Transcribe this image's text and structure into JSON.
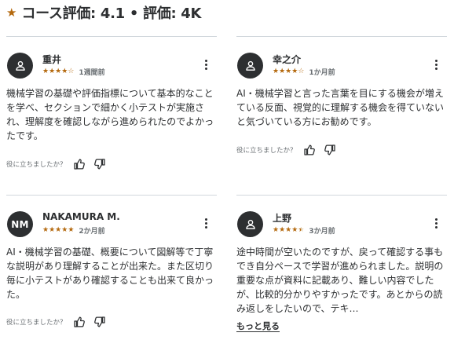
{
  "header": {
    "title": "コース評価: 4.1 • 評価: 4K",
    "star_icon": "star-icon",
    "accent_color": "#b4690e"
  },
  "helpful_label": "役に立ちましたか？",
  "reviews": [
    {
      "name": "重井",
      "avatar_icon": "user-icon",
      "avatar_initials": "",
      "rating": 4,
      "time": "1週間前",
      "text": "機械学習の基礎や評価指標について基本的なことを学べ、セクションで細かく小テストが実施され、理解度を確認しながら進められたのでよかったです。"
    },
    {
      "name": "幸之介",
      "avatar_icon": "user-icon",
      "avatar_initials": "",
      "rating": 4,
      "time": "1か月前",
      "text": "AI・機械学習と言った言葉を目にする機会が増えている反面、視覚的に理解する機会を得ていないと気づいている方にお勧めです。"
    },
    {
      "name": "NAKAMURA M.",
      "avatar_icon": "",
      "avatar_initials": "NM",
      "rating": 5,
      "time": "2か月前",
      "text": "AI・機械学習の基礎、概要について図解等で丁寧な説明があり理解することが出来た。また区切り毎に小テストがあり確認することも出来て良かった。"
    },
    {
      "name": "上野",
      "avatar_icon": "user-icon",
      "avatar_initials": "",
      "rating": 4.5,
      "time": "3か月前",
      "text": "途中時間が空いたのですが、戻って確認する事もでき自分ペースで学習が進められました。説明の重要な点が資料に記載あり、難しい内容でしたが、比較的分かりやすかったです。あとからの読み返しをしたいので、テキ…",
      "more_label": "もっと見る"
    }
  ]
}
